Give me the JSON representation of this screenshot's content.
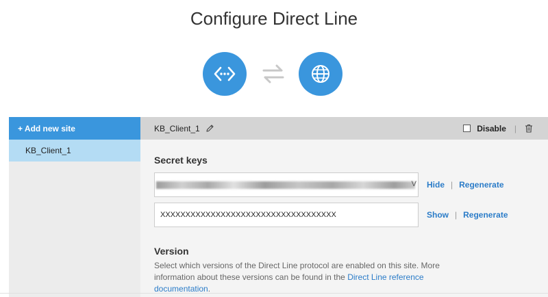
{
  "page": {
    "title": "Configure Direct Line"
  },
  "icons": {
    "left_circle": "code-brackets-icon",
    "swap": "swap-arrows-icon",
    "right_circle": "globe-icon",
    "accent": "#3a96dd"
  },
  "sidebar": {
    "add_label": "+ Add new site",
    "items": [
      {
        "label": "KB_Client_1",
        "selected": true
      }
    ]
  },
  "header": {
    "site_name": "KB_Client_1",
    "disable_label": "Disable",
    "disable_checked": false
  },
  "secret_keys": {
    "title": "Secret keys",
    "key1": {
      "value_tail": "V",
      "redacted": true,
      "toggle_label": "Hide",
      "regenerate_label": "Regenerate"
    },
    "key2": {
      "value": "XXXXXXXXXXXXXXXXXXXXXXXXXXXXXXXXXXX",
      "toggle_label": "Show",
      "regenerate_label": "Regenerate"
    }
  },
  "version": {
    "title": "Version",
    "desc_before": "Select which versions of the Direct Line protocol are enabled on this site. More information about these versions can be found in the ",
    "link_text": "Direct Line reference documentation",
    "desc_after": "."
  }
}
